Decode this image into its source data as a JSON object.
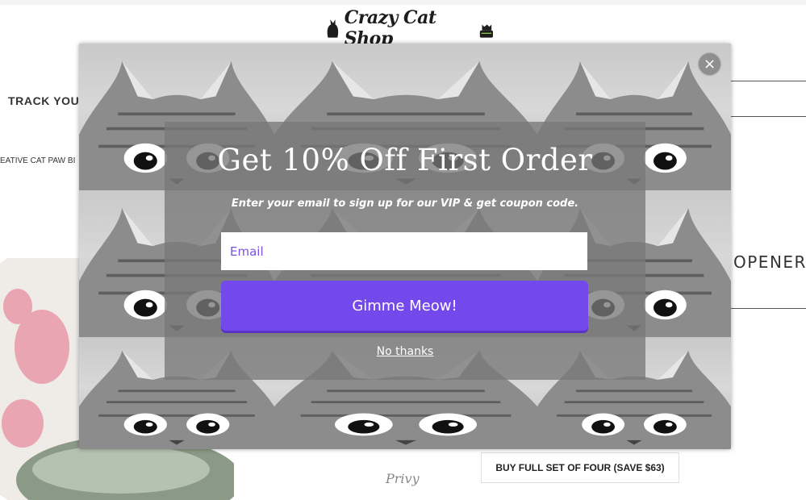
{
  "header": {
    "logo_text": "Crazy Cat Shop"
  },
  "page": {
    "track_label": "TRACK YOUR",
    "product_title_fragment": "EATIVE CAT PAW BI",
    "product_heading_fragment": "OPENER -",
    "buy_set_label": "BUY FULL SET OF FOUR (SAVE $63)",
    "brand_mark": "Privy"
  },
  "popup": {
    "headline": "Get 10% Off First Order",
    "subheadline": "Enter your email to sign up for our VIP & get coupon code.",
    "email_placeholder": "Email",
    "submit_label": "Gimme Meow!",
    "dismiss_label": "No thanks",
    "close_glyph": "×",
    "accent_color": "#7349ec",
    "background_icon": "peeking-cat-photo-tile"
  }
}
